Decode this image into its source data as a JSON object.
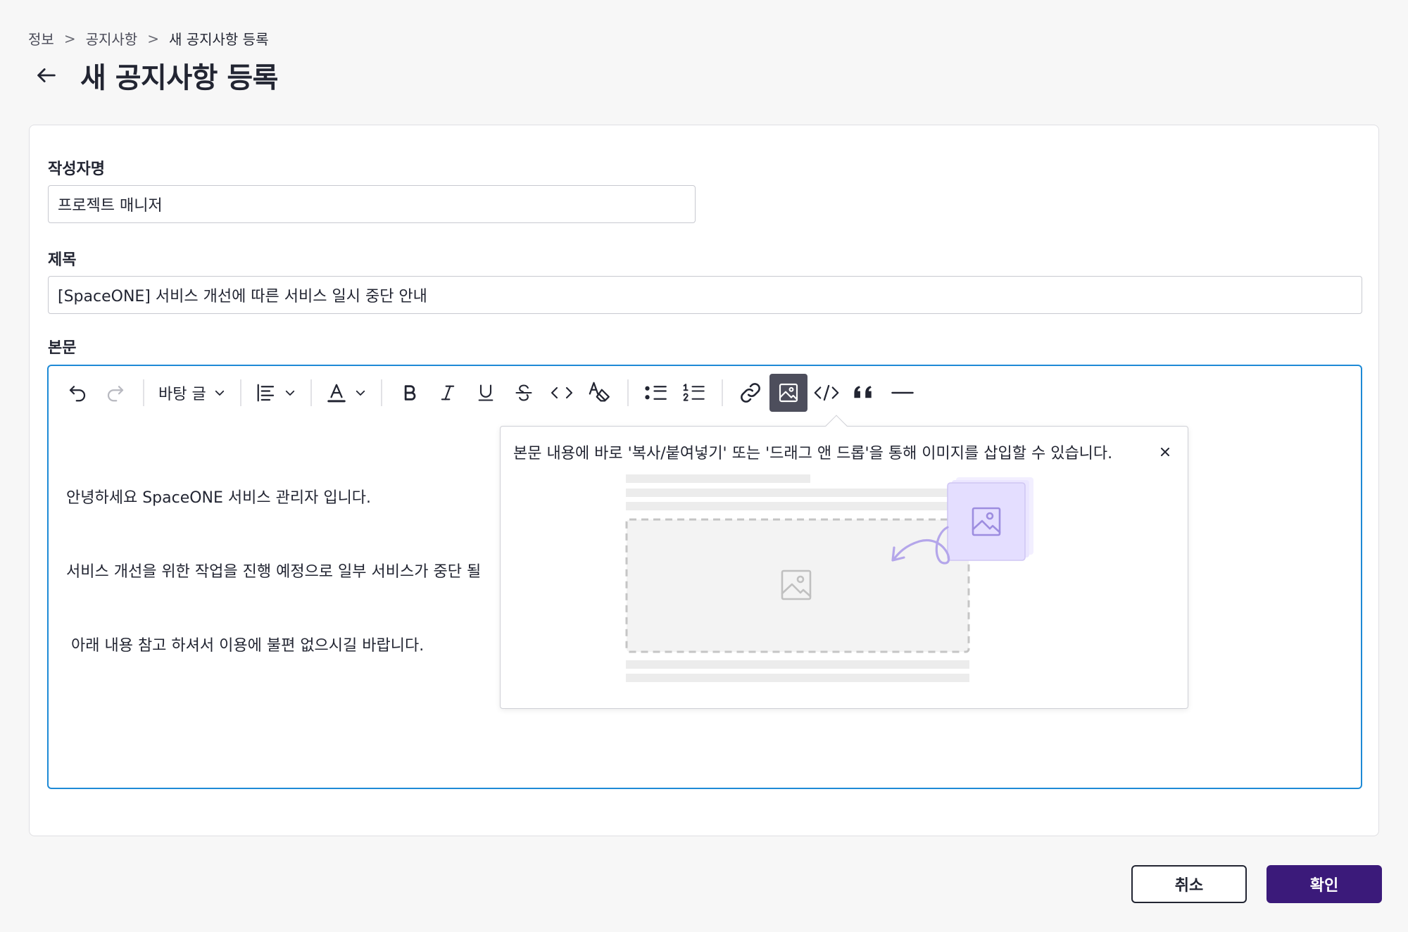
{
  "breadcrumb": {
    "items": [
      "정보",
      "공지사항",
      "새 공지사항 등록"
    ],
    "separator": ">"
  },
  "page": {
    "title": "새 공지사항 등록"
  },
  "form": {
    "author": {
      "label": "작성자명",
      "value": "프로젝트 매니저"
    },
    "subject": {
      "label": "제목",
      "value": "[SpaceONE] 서비스 개선에 따른 서비스 일시 중단 안내"
    },
    "body": {
      "label": "본문"
    }
  },
  "toolbar": {
    "paragraph_style": "바탕 글",
    "active_tool": "image"
  },
  "editor": {
    "lines": [
      "안녕하세요 SpaceONE 서비스 관리자 입니다.",
      "서비스 개선을 위한 작업을 진행 예정으로 일부 서비스가 중단 될",
      " 아래 내용 참고 하셔서 이용에 불편 없으시길 바랍니다."
    ]
  },
  "image_popover": {
    "message": "본문 내용에 바로 '복사/붙여넣기' 또는 '드래그 앤 드롭'을 통해 이미지를 삽입할 수 있습니다."
  },
  "actions": {
    "cancel_label": "취소",
    "confirm_label": "확인"
  },
  "colors": {
    "primary": "#3b1a7a",
    "editor_focus_border": "#1e8ad6",
    "illustration_accent": "#b4a6ea"
  }
}
